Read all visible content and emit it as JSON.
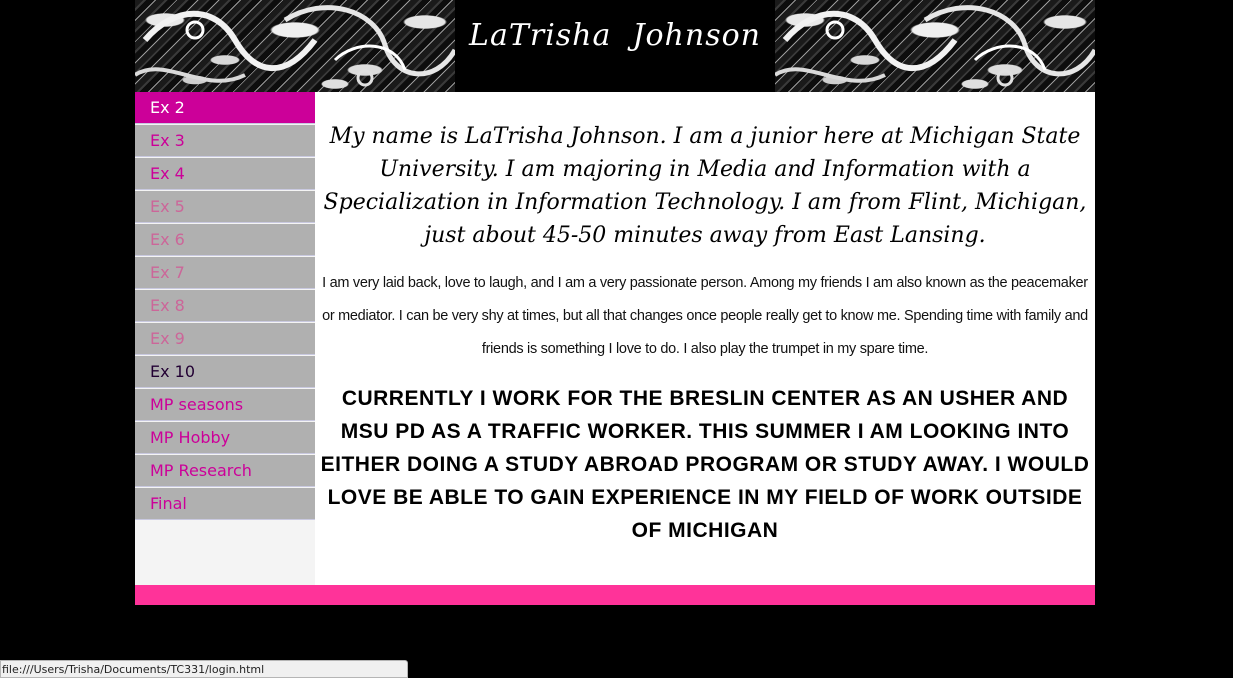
{
  "header": {
    "title": "LaTrisha  Johnson"
  },
  "nav": {
    "items": [
      {
        "label": "Ex 2",
        "color": "#ffffff",
        "active": true
      },
      {
        "label": "Ex 3",
        "color": "#cc0099"
      },
      {
        "label": "Ex 4",
        "color": "#cc0099"
      },
      {
        "label": "Ex 5",
        "color": "#cc6699"
      },
      {
        "label": "Ex 6",
        "color": "#cc6699"
      },
      {
        "label": "Ex 7",
        "color": "#cc6699"
      },
      {
        "label": "Ex 8",
        "color": "#cc6699"
      },
      {
        "label": "Ex 9",
        "color": "#cc6699"
      },
      {
        "label": "Ex 10",
        "color": "#220033"
      },
      {
        "label": "MP seasons",
        "color": "#cc0099"
      },
      {
        "label": "MP Hobby",
        "color": "#cc0099"
      },
      {
        "label": "MP Research",
        "color": "#cc0099"
      },
      {
        "label": "Final",
        "color": "#cc0099"
      }
    ]
  },
  "content": {
    "intro": "My name is LaTrisha Johnson. I am a junior here at Michigan State University. I am majoring in Media and Information with a Specialization in Information Technology. I am from Flint, Michigan, just about 45-50 minutes away from East Lansing.",
    "about": "I am very laid back, love to laugh, and I am a very passionate person. Among my friends I am also known as the peacemaker or mediator. I can be very shy at times, but all that changes once people really get to know me. Spending time with family and friends is something I love to do. I also play the trumpet in my spare time.",
    "work": "Currently I work for the Breslin Center as an usher and MSU PD as a traffic worker. This summer I am looking into either doing a study abroad program or study away. I would love be able to gain experience in my field of work outside of Michigan"
  },
  "status_bar": {
    "url": "file:///Users/Trisha/Documents/TC331/login.html"
  },
  "colors": {
    "active_nav": "#cc0099",
    "nav_bg": "#b0b0b0",
    "footer": "#ff3399",
    "background": "#000000"
  }
}
